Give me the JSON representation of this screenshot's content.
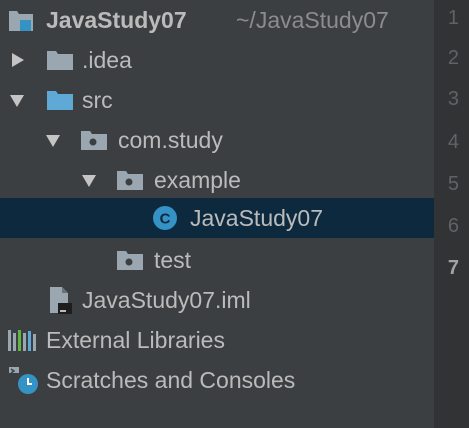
{
  "project": {
    "name": "JavaStudy07",
    "path": "~/JavaStudy07"
  },
  "tree": {
    "idea": ".idea",
    "src": "src",
    "package": "com.study",
    "subpackage": "example",
    "class_file": "JavaStudy07",
    "test": "test",
    "iml": "JavaStudy07.iml",
    "external_libraries": "External Libraries",
    "scratches": "Scratches and Consoles"
  },
  "gutter": {
    "line_numbers": [
      "1",
      "2",
      "3",
      "4",
      "5",
      "6",
      "7"
    ]
  },
  "colors": {
    "background": "#3c3f41",
    "selection": "#0d293e",
    "folder": "#9aa7b0",
    "source_folder": "#5fa9d6",
    "class_icon": "#3592c4"
  }
}
